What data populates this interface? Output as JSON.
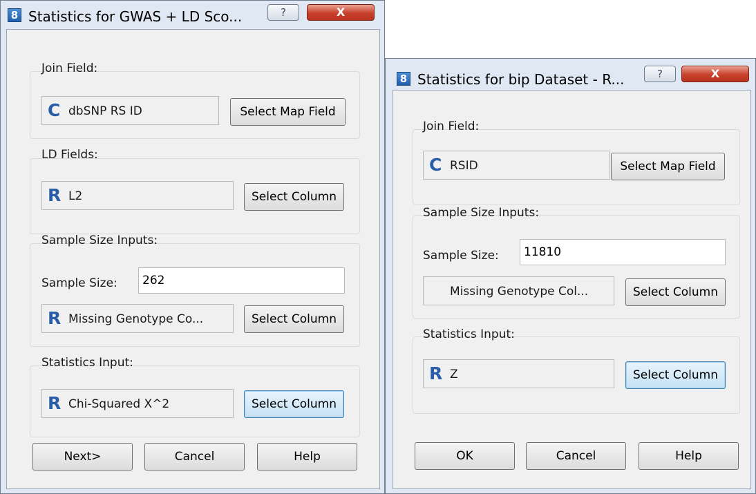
{
  "dialog1": {
    "title": "Statistics for GWAS + LD Sco...",
    "icon_glyph": "8",
    "help_glyph": "?",
    "close_glyph": "X",
    "join": {
      "label": "Join Field:",
      "type_glyph": "C",
      "value": "dbSNP RS ID",
      "button": "Select Map Field"
    },
    "ld": {
      "label": "LD Fields:",
      "type_glyph": "R",
      "value": "L2",
      "button": "Select Column"
    },
    "sample": {
      "label": "Sample Size Inputs:",
      "size_label": "Sample Size:",
      "size_value": "262",
      "missing_type_glyph": "R",
      "missing_value": "Missing Genotype Co...",
      "button": "Select Column"
    },
    "stats": {
      "label": "Statistics Input:",
      "type_glyph": "R",
      "value": "Chi-Squared  X^2",
      "button": "Select Column"
    },
    "footer": {
      "next": "Next>",
      "cancel": "Cancel",
      "help": "Help"
    }
  },
  "dialog2": {
    "title": "Statistics for bip Dataset - R...",
    "icon_glyph": "8",
    "help_glyph": "?",
    "close_glyph": "X",
    "join": {
      "label": "Join Field:",
      "type_glyph": "C",
      "value": "RSID",
      "button": "Select Map Field"
    },
    "sample": {
      "label": "Sample Size Inputs:",
      "size_label": "Sample Size:",
      "size_value": "11810",
      "missing_value": "Missing Genotype Col...",
      "button": "Select Column"
    },
    "stats": {
      "label": "Statistics Input:",
      "type_glyph": "R",
      "value": "Z",
      "button": "Select Column"
    },
    "footer": {
      "ok": "OK",
      "cancel": "Cancel",
      "help": "Help"
    }
  }
}
